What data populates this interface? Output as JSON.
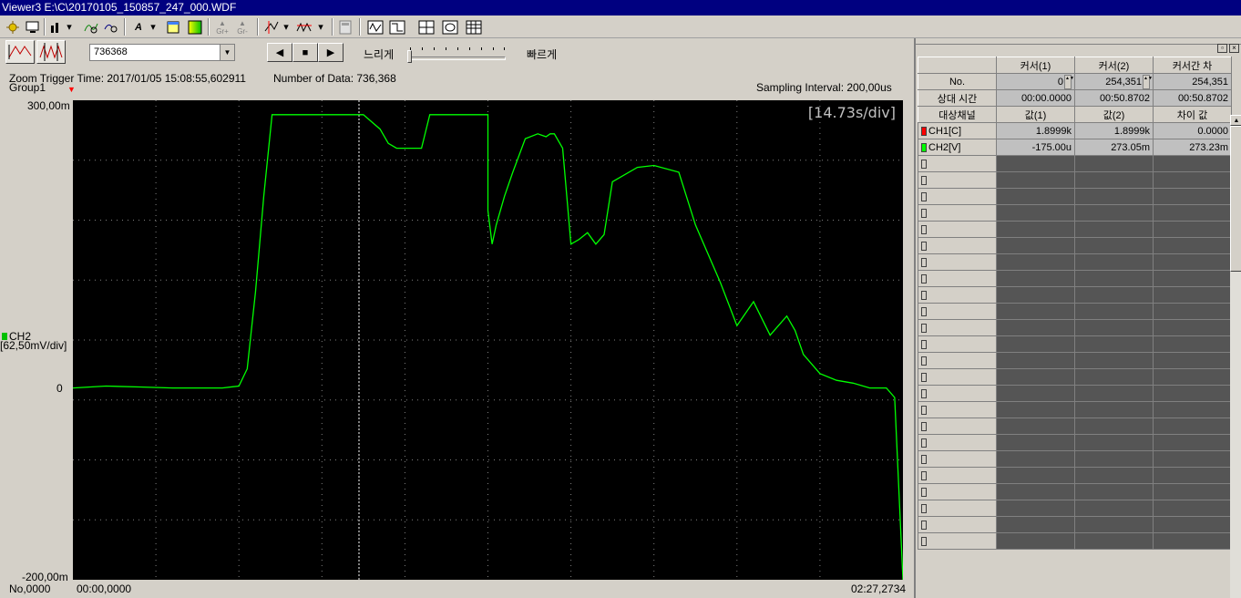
{
  "window": {
    "title": "Viewer3 E:\\C\\20170105_150857_247_000.WDF"
  },
  "toolbar": {
    "gr_plus": "Gr+",
    "gr_minus": "Gr-"
  },
  "controls": {
    "position_value": "736368",
    "slow_label": "느리게",
    "fast_label": "빠르게"
  },
  "info": {
    "zoom_trigger": "Zoom Trigger Time: 2017/01/05 15:08:55,602911",
    "number_of_data": "Number of Data: 736,368",
    "group": "Group1",
    "sampling": "Sampling Interval:  200,00us",
    "time_div": "[14.73s/div]"
  },
  "axis": {
    "y_top": "300,00m",
    "y_zero": "0",
    "y_bottom": "-200,00m",
    "channel": "CH2",
    "scale": "[62,50mV/div]",
    "no_label": "No,0000",
    "x_start": "00:00,0000",
    "x_end": "02:27,2734"
  },
  "chart_data": {
    "type": "line",
    "series": [
      {
        "name": "CH2",
        "color": "#00ff00",
        "t_fraction": [
          0,
          0.04,
          0.08,
          0.12,
          0.16,
          0.18,
          0.2,
          0.21,
          0.22,
          0.23,
          0.24,
          0.25,
          0.3,
          0.35,
          0.37,
          0.38,
          0.39,
          0.41,
          0.42,
          0.43,
          0.5,
          0.5,
          0.505,
          0.51,
          0.52,
          0.53,
          0.545,
          0.56,
          0.57,
          0.575,
          0.58,
          0.59,
          0.6,
          0.61,
          0.62,
          0.63,
          0.64,
          0.65,
          0.68,
          0.7,
          0.73,
          0.75,
          0.78,
          0.8,
          0.82,
          0.84,
          0.86,
          0.87,
          0.88,
          0.89,
          0.9,
          0.92,
          0.94,
          0.96,
          0.98,
          0.99,
          1.0
        ],
        "value_mV": [
          0,
          2,
          1,
          0,
          0,
          0,
          2,
          20,
          100,
          200,
          285,
          285,
          285,
          285,
          270,
          255,
          250,
          250,
          250,
          285,
          285,
          185,
          150,
          170,
          200,
          225,
          260,
          265,
          262,
          265,
          265,
          250,
          150,
          155,
          162,
          150,
          160,
          215,
          230,
          232,
          225,
          170,
          110,
          65,
          90,
          55,
          75,
          60,
          35,
          25,
          15,
          8,
          5,
          0,
          0,
          -10,
          -200
        ]
      }
    ],
    "ylim": [
      -200,
      300
    ],
    "y_unit": "mV"
  },
  "panel": {
    "headers": [
      "커서(1)",
      "커서(2)",
      "커서간 차"
    ],
    "no_label": "No.",
    "no_values": [
      "0",
      "254,351",
      "254,351"
    ],
    "rel_label": "상대 시간",
    "rel_values": [
      "00:00.0000",
      "00:50.8702",
      "00:50.8702"
    ],
    "target_label": "대상채널",
    "value_headers": [
      "값(1)",
      "값(2)",
      "차이 값"
    ],
    "channels": [
      {
        "name": "CH1[C]",
        "color": "#ff0000",
        "v1": "1.8999k",
        "v2": "1.8999k",
        "diff": "0.0000"
      },
      {
        "name": "CH2[V]",
        "color": "#00ff00",
        "v1": "-175.00u",
        "v2": "273.05m",
        "diff": "273.23m"
      }
    ]
  }
}
